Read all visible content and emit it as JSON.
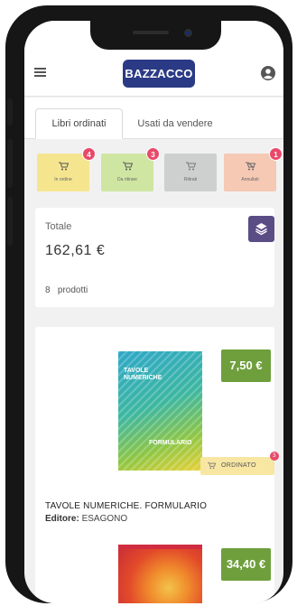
{
  "header": {
    "logo_text": "BAZZACCO",
    "brand_color": "#2b3a85"
  },
  "tabs": [
    {
      "label": "Libri ordinati",
      "active": true
    },
    {
      "label": "Usati da vendere",
      "active": false
    }
  ],
  "status_cards": [
    {
      "label": "In ordine",
      "count": "4",
      "color": "#f5e58f"
    },
    {
      "label": "Da ritirare",
      "count": "3",
      "color": "#cfe6a2"
    },
    {
      "label": "Ritirati",
      "count": "",
      "color": "#cdd0cf"
    },
    {
      "label": "Annullati",
      "count": "1",
      "color": "#f5c9b4"
    }
  ],
  "summary": {
    "total_label": "Totale",
    "total_value": "162,61 €",
    "count_number": "8",
    "count_label": "prodotti"
  },
  "products": [
    {
      "cover_title": "TAVOLE NUMERICHE",
      "cover_subtitle": "FORMULARIO",
      "price": "7,50 €",
      "status": "ORDINATO",
      "status_count": "3",
      "title": "TAVOLE NUMERICHE. FORMULARIO",
      "editor_label": "Editore:",
      "editor": "ESAGONO"
    },
    {
      "price": "34,40 €"
    }
  ],
  "icons": [
    "menu-icon",
    "user-icon",
    "cart-icon",
    "layers-icon"
  ]
}
